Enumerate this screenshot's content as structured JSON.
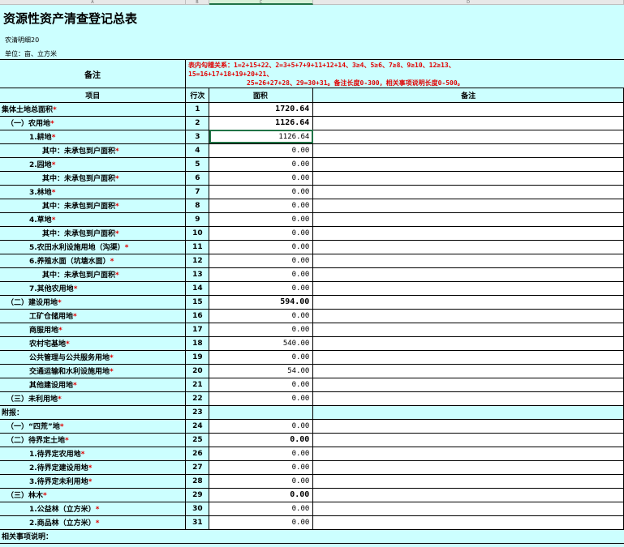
{
  "column_headers": [
    "A",
    "B",
    "C",
    "D"
  ],
  "title": "资源性资产清查登记总表",
  "subtitle": "农清明细20",
  "unit": "单位：亩、立方米",
  "note_label": "备注",
  "note_lines": [
    "表内勾稽关系：1=2+15+22、2=3+5+7+9+11+12+14、3≥4、5≥6、7≥8、9≥10、12≥13、",
    "15=16+17+18+19+20+21、",
    "25=26+27+28、29=30+31。备注长度0-300，相关事项说明长度0-500。"
  ],
  "table_header": {
    "item": "项目",
    "row_no": "行次",
    "area": "面积",
    "remark": "备注"
  },
  "rows": [
    {
      "label": "集体土地总面积",
      "no": "1",
      "area": "1720.64"
    },
    {
      "label": "（一）农用地",
      "no": "2",
      "area": "1126.64"
    },
    {
      "label": "1.耕地",
      "no": "3",
      "area": "1126.64"
    },
    {
      "label": "其中：未承包到户面积",
      "no": "4",
      "area": "0.00"
    },
    {
      "label": "2.园地",
      "no": "5",
      "area": "0.00"
    },
    {
      "label": "其中：未承包到户面积",
      "no": "6",
      "area": "0.00"
    },
    {
      "label": "3.林地",
      "no": "7",
      "area": "0.00"
    },
    {
      "label": "其中：未承包到户面积",
      "no": "8",
      "area": "0.00"
    },
    {
      "label": "4.草地",
      "no": "9",
      "area": "0.00"
    },
    {
      "label": "其中：未承包到户面积",
      "no": "10",
      "area": "0.00"
    },
    {
      "label": "5.农田水利设施用地（沟渠）",
      "no": "11",
      "area": "0.00"
    },
    {
      "label": "6.养殖水面（坑塘水面）",
      "no": "12",
      "area": "0.00"
    },
    {
      "label": "其中：未承包到户面积",
      "no": "13",
      "area": "0.00"
    },
    {
      "label": "7.其他农用地",
      "no": "14",
      "area": "0.00"
    },
    {
      "label": "（二）建设用地",
      "no": "15",
      "area": "594.00"
    },
    {
      "label": "工矿仓储用地",
      "no": "16",
      "area": "0.00"
    },
    {
      "label": "商服用地",
      "no": "17",
      "area": "0.00"
    },
    {
      "label": "农村宅基地",
      "no": "18",
      "area": "540.00"
    },
    {
      "label": "公共管理与公共服务用地",
      "no": "19",
      "area": "0.00"
    },
    {
      "label": "交通运输和水利设施用地",
      "no": "20",
      "area": "54.00"
    },
    {
      "label": "其他建设用地",
      "no": "21",
      "area": "0.00"
    },
    {
      "label": "（三）未利用地",
      "no": "22",
      "area": "0.00"
    },
    {
      "label": "附报：",
      "no": "23",
      "area": ""
    },
    {
      "label": "（一）“四荒”地",
      "no": "24",
      "area": "0.00"
    },
    {
      "label": "（二）待界定土地",
      "no": "25",
      "area": "0.00"
    },
    {
      "label": "1.待界定农用地",
      "no": "26",
      "area": "0.00"
    },
    {
      "label": "2.待界定建设用地",
      "no": "27",
      "area": "0.00"
    },
    {
      "label": "3.待界定未利用地",
      "no": "28",
      "area": "0.00"
    },
    {
      "label": "（三）林木",
      "no": "29",
      "area": "0.00"
    },
    {
      "label": "1.公益林（立方米）",
      "no": "30",
      "area": "0.00"
    },
    {
      "label": "2.商品林（立方米）",
      "no": "31",
      "area": "0.00"
    }
  ],
  "footer_label": "相关事项说明：",
  "required_mark": "*"
}
